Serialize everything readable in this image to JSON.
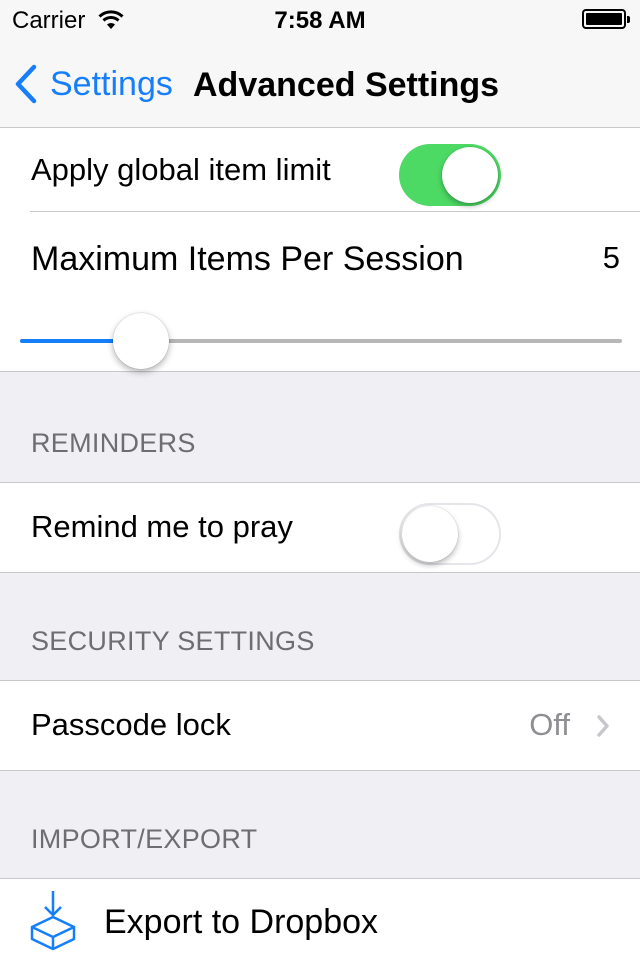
{
  "status_bar": {
    "carrier": "Carrier",
    "time": "7:58 AM"
  },
  "nav": {
    "back_label": "Settings",
    "title": "Advanced Settings"
  },
  "limits": {
    "apply_label": "Apply global item limit",
    "apply_on": true,
    "max_label": "Maximum Items Per Session",
    "max_value": "5",
    "slider_fraction": 0.17
  },
  "reminders": {
    "header": "REMINDERS",
    "remind_label": "Remind me to pray",
    "remind_on": false
  },
  "security": {
    "header": "SECURITY SETTINGS",
    "passcode_label": "Passcode lock",
    "passcode_value": "Off"
  },
  "import_export": {
    "header": "IMPORT/EXPORT",
    "export_label": "Export to Dropbox",
    "export_icon": "dropbox-export-icon"
  },
  "colors": {
    "accent": "#157efb",
    "toggle_on": "#4cd964",
    "background": "#efeff4",
    "header_text": "#6d6d72",
    "secondary_text": "#8e8e93"
  }
}
